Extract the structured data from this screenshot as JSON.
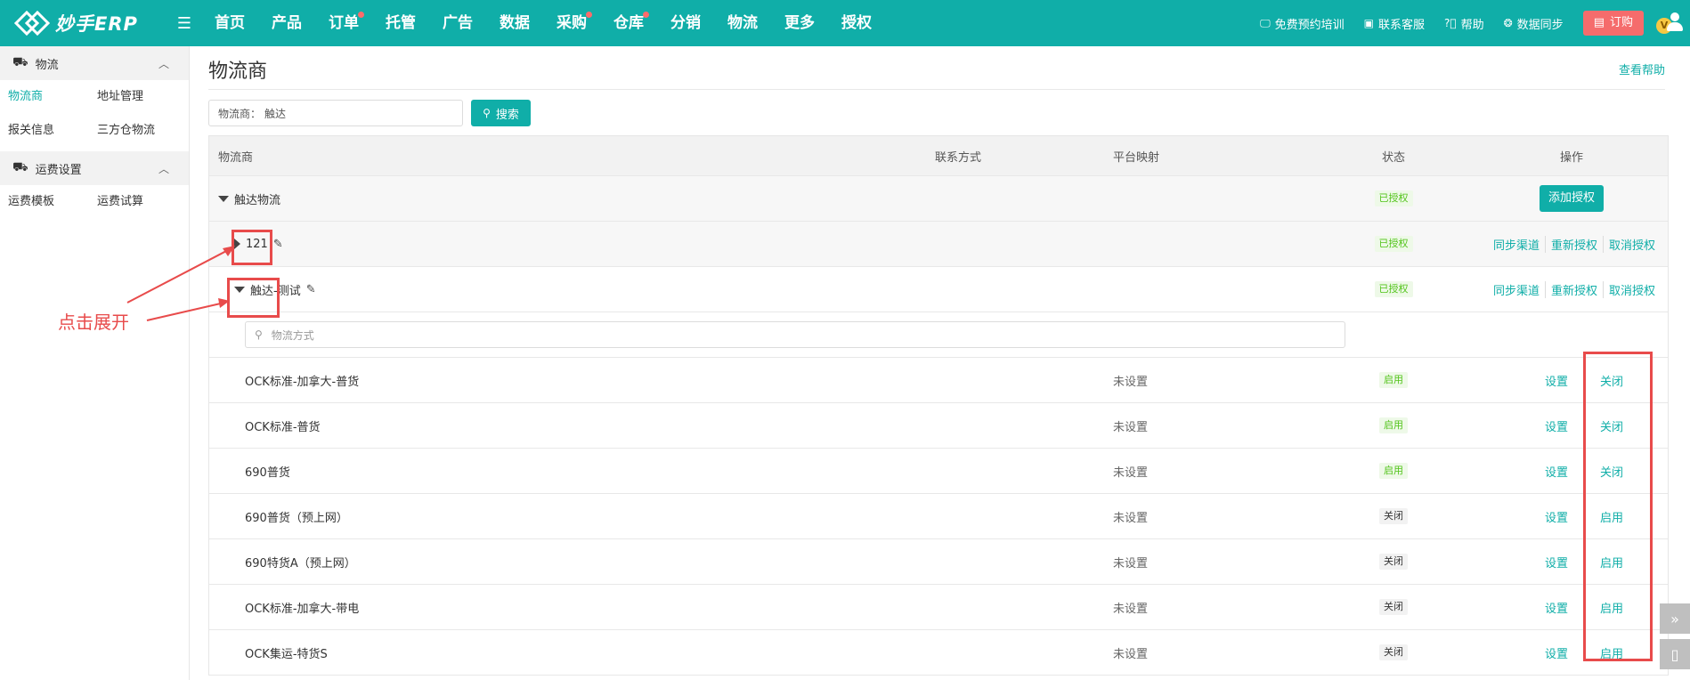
{
  "app": {
    "logo_text": "妙手ERP",
    "brand_color": "#10aea8"
  },
  "nav": {
    "items": [
      {
        "label": "首页",
        "dot": false
      },
      {
        "label": "产品",
        "dot": false
      },
      {
        "label": "订单",
        "dot": true
      },
      {
        "label": "托管",
        "dot": false
      },
      {
        "label": "广告",
        "dot": false
      },
      {
        "label": "数据",
        "dot": false
      },
      {
        "label": "采购",
        "dot": true
      },
      {
        "label": "仓库",
        "dot": true
      },
      {
        "label": "分销",
        "dot": false
      },
      {
        "label": "物流",
        "dot": false
      },
      {
        "label": "更多",
        "dot": false
      },
      {
        "label": "授权",
        "dot": false
      }
    ]
  },
  "topright": {
    "training": "免费预约培训",
    "service": "联系客服",
    "help": "帮助",
    "sync": "数据同步",
    "order": "订购",
    "avatar_badge": "V"
  },
  "sidebar": {
    "groups": [
      {
        "title": "物流",
        "items": [
          "物流商",
          "地址管理",
          "报关信息",
          "三方仓物流"
        ]
      },
      {
        "title": "运费设置",
        "items": [
          "运费模板",
          "运费试算"
        ]
      }
    ],
    "active_item": "物流商"
  },
  "page": {
    "title": "物流商",
    "help": "查看帮助"
  },
  "search": {
    "label": "物流商：",
    "value": "触达",
    "button": "搜索"
  },
  "table": {
    "headers": {
      "name": "物流商",
      "contact": "联系方式",
      "platform": "平台映射",
      "status": "状态",
      "ops": "操作"
    },
    "provider": {
      "name": "触达物流",
      "status": "已授权",
      "add_button": "添加授权"
    },
    "accounts": [
      {
        "name": "121",
        "expanded": false,
        "status": "已授权",
        "ops": [
          "同步渠道",
          "重新授权",
          "取消授权"
        ]
      },
      {
        "name": "触达-测试",
        "expanded": true,
        "status": "已授权",
        "ops": [
          "同步渠道",
          "重新授权",
          "取消授权"
        ]
      }
    ],
    "filter_placeholder": "物流方式",
    "methods": [
      {
        "name": "OCK标准-加拿大-普货",
        "platform": "未设置",
        "status": "启用",
        "on": true,
        "set": "设置",
        "toggle": "关闭"
      },
      {
        "name": "OCK标准-普货",
        "platform": "未设置",
        "status": "启用",
        "on": true,
        "set": "设置",
        "toggle": "关闭"
      },
      {
        "name": "690普货",
        "platform": "未设置",
        "status": "启用",
        "on": true,
        "set": "设置",
        "toggle": "关闭"
      },
      {
        "name": "690普货（预上网）",
        "platform": "未设置",
        "status": "关闭",
        "on": false,
        "set": "设置",
        "toggle": "启用"
      },
      {
        "name": "690特货A（预上网）",
        "platform": "未设置",
        "status": "关闭",
        "on": false,
        "set": "设置",
        "toggle": "启用"
      },
      {
        "name": "OCK标准-加拿大-带电",
        "platform": "未设置",
        "status": "关闭",
        "on": false,
        "set": "设置",
        "toggle": "启用"
      },
      {
        "name": "OCK集运-特货S",
        "platform": "未设置",
        "status": "关闭",
        "on": false,
        "set": "设置",
        "toggle": "启用"
      }
    ]
  },
  "annotation": {
    "label": "点击展开",
    "color": "#e84b4b"
  }
}
